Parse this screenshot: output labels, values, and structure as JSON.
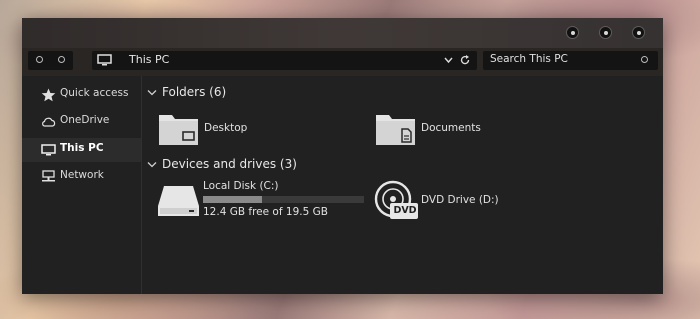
{
  "window": {
    "controls": [
      "minimize",
      "maximize",
      "close"
    ]
  },
  "toolbar": {
    "address_text": "This PC",
    "search_placeholder": "Search This PC"
  },
  "sidebar": {
    "items": [
      {
        "label": "Quick access",
        "icon": "star-icon"
      },
      {
        "label": "OneDrive",
        "icon": "cloud-icon"
      },
      {
        "label": "This PC",
        "icon": "monitor-icon",
        "selected": true
      },
      {
        "label": "Network",
        "icon": "network-icon"
      }
    ]
  },
  "main": {
    "folders_header": "Folders (6)",
    "folders": [
      {
        "label": "Desktop",
        "icon": "desktop-folder-icon"
      },
      {
        "label": "Documents",
        "icon": "documents-folder-icon"
      }
    ],
    "devices_header": "Devices and drives (3)",
    "drives": [
      {
        "label": "Local Disk (C:)",
        "free_text": "12.4 GB free of 19.5 GB",
        "used_fraction": 0.364,
        "icon": "hard-disk-icon"
      },
      {
        "label": "DVD Drive (D:)",
        "icon": "dvd-drive-icon",
        "badge": "DVD"
      }
    ]
  }
}
